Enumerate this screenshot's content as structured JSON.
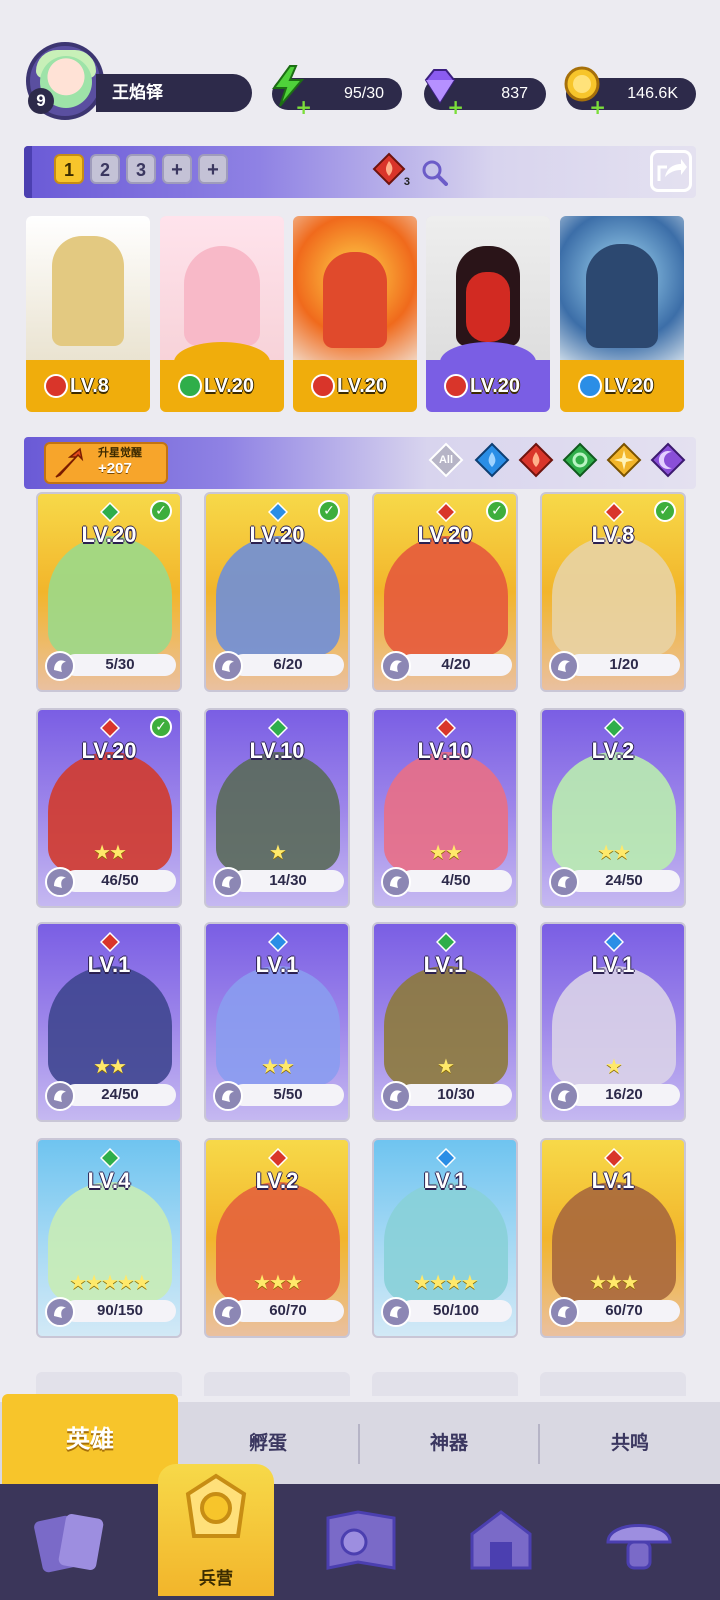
{
  "player": {
    "level": "9",
    "name": "王焰铎"
  },
  "resources": {
    "energy": "95/30",
    "gems": "837",
    "coins": "146.6K"
  },
  "team": {
    "slots": [
      "1",
      "2",
      "3",
      "+",
      "+"
    ],
    "fire_count": "3",
    "cards": [
      {
        "level": "LV.8",
        "element": "fire",
        "style": "gold"
      },
      {
        "level": "LV.20",
        "element": "nature",
        "style": "gold"
      },
      {
        "level": "LV.20",
        "element": "fire",
        "style": "gold"
      },
      {
        "level": "LV.20",
        "element": "fire",
        "style": "purple"
      },
      {
        "level": "LV.20",
        "element": "water",
        "style": "gold"
      }
    ]
  },
  "filter": {
    "awaken_title": "升星觉醒",
    "awaken_count": "+207",
    "all_label": "All",
    "chips": [
      "all",
      "water",
      "fire",
      "nature",
      "light",
      "dark"
    ]
  },
  "heroes": [
    {
      "level": "LV.20",
      "progress": "5/30",
      "element": "nature",
      "rarity": "gold",
      "checked": true,
      "stars": "",
      "char_color": "#9bd98a"
    },
    {
      "level": "LV.20",
      "progress": "6/20",
      "element": "water",
      "rarity": "gold",
      "checked": true,
      "stars": "",
      "char_color": "#6f8fd8"
    },
    {
      "level": "LV.20",
      "progress": "4/20",
      "element": "fire",
      "rarity": "gold",
      "checked": true,
      "stars": "",
      "char_color": "#e65a3c"
    },
    {
      "level": "LV.8",
      "progress": "1/20",
      "element": "fire",
      "rarity": "gold",
      "checked": true,
      "stars": "",
      "char_color": "#e8d3a4"
    },
    {
      "level": "LV.20",
      "progress": "46/50",
      "element": "fire",
      "rarity": "purple",
      "checked": true,
      "stars": "★★",
      "char_color": "#d23b2e"
    },
    {
      "level": "LV.10",
      "progress": "14/30",
      "element": "nature",
      "rarity": "purple",
      "checked": false,
      "stars": "★",
      "char_color": "#5a6a5a"
    },
    {
      "level": "LV.10",
      "progress": "4/50",
      "element": "fire",
      "rarity": "purple",
      "checked": false,
      "stars": "★★",
      "char_color": "#e96f86"
    },
    {
      "level": "LV.2",
      "progress": "24/50",
      "element": "nature",
      "rarity": "purple",
      "checked": false,
      "stars": "★★",
      "char_color": "#b9ecb0"
    },
    {
      "level": "LV.1",
      "progress": "24/50",
      "element": "fire",
      "rarity": "purple",
      "checked": false,
      "stars": "★★",
      "char_color": "#3f4690"
    },
    {
      "level": "LV.1",
      "progress": "5/50",
      "element": "water",
      "rarity": "purple",
      "checked": false,
      "stars": "★★",
      "char_color": "#8a9cf0"
    },
    {
      "level": "LV.1",
      "progress": "10/30",
      "element": "nature",
      "rarity": "purple",
      "checked": false,
      "stars": "★",
      "char_color": "#8d7a3c"
    },
    {
      "level": "LV.1",
      "progress": "16/20",
      "element": "water",
      "rarity": "purple",
      "checked": false,
      "stars": "★",
      "char_color": "#d9d2e8"
    },
    {
      "level": "LV.4",
      "progress": "90/150",
      "element": "nature",
      "rarity": "blue",
      "checked": false,
      "stars": "★★★★★",
      "char_color": "#c8ecb6"
    },
    {
      "level": "LV.2",
      "progress": "60/70",
      "element": "fire",
      "rarity": "gold",
      "checked": false,
      "stars": "★★★",
      "char_color": "#e4623c"
    },
    {
      "level": "LV.1",
      "progress": "50/100",
      "element": "water",
      "rarity": "blue",
      "checked": false,
      "stars": "★★★★",
      "char_color": "#88d0d8"
    },
    {
      "level": "LV.1",
      "progress": "60/70",
      "element": "fire",
      "rarity": "gold",
      "checked": false,
      "stars": "★★★",
      "char_color": "#a8683c"
    }
  ],
  "subtabs": [
    "英雄",
    "孵蛋",
    "神器",
    "共鸣"
  ],
  "bottom_nav": {
    "active_label": "兵营"
  },
  "colors": {
    "fire": "#d9352a",
    "water": "#2a8ee6",
    "nature": "#2fae4a",
    "light": "#f2b52b",
    "dark": "#8a4fd8",
    "accent_gold": "#f7c52b",
    "nav_bg": "#3b365a"
  }
}
